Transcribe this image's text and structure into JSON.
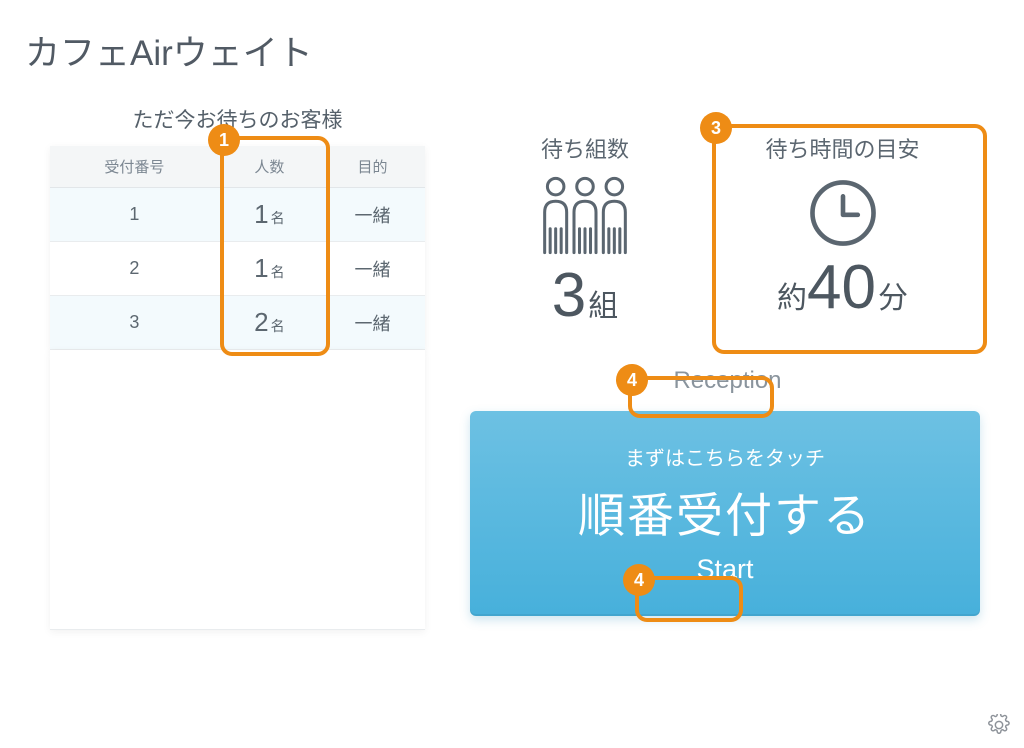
{
  "title": "カフェAirウェイト",
  "left": {
    "heading": "ただ今お待ちのお客様",
    "columns": {
      "ticket": "受付番号",
      "count": "人数",
      "purpose": "目的"
    },
    "rows": [
      {
        "ticket": "1",
        "count_num": "1",
        "count_unit": "名",
        "purpose": "一緒"
      },
      {
        "ticket": "2",
        "count_num": "1",
        "count_unit": "名",
        "purpose": "一緒"
      },
      {
        "ticket": "3",
        "count_num": "2",
        "count_unit": "名",
        "purpose": "一緒"
      }
    ]
  },
  "right": {
    "groups_label": "待ち組数",
    "groups_value": "3",
    "groups_unit": "組",
    "time_label": "待ち時間の目安",
    "time_prefix": "約",
    "time_value": "40",
    "time_unit": "分",
    "reception_label": "Reception",
    "start_sub": "まずはこちらをタッチ",
    "start_main": "順番受付する",
    "start_en": "Start"
  },
  "callouts": {
    "c1": "1",
    "c3": "3",
    "c4a": "4",
    "c4b": "4"
  }
}
